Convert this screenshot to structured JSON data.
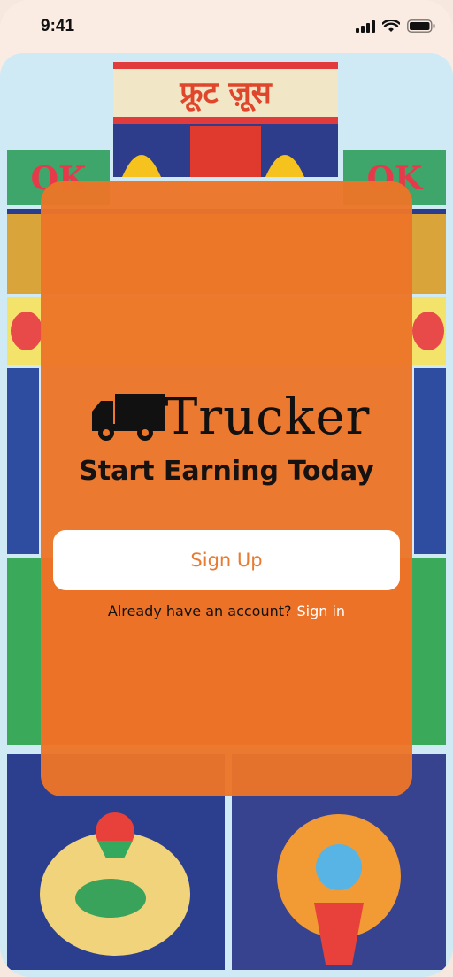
{
  "status": {
    "time": "9:41"
  },
  "art": {
    "top_banner": "फ्रूट ज़ूस",
    "side_label_left": "OK",
    "side_label_right": "OK"
  },
  "hero": {
    "brand": "Trucker",
    "tagline": "Start Earning Today"
  },
  "actions": {
    "signup_label": "Sign Up",
    "account_prompt": "Already have an account?",
    "signin_label": "Sign in"
  },
  "colors": {
    "card": "#EC7528",
    "accent": "#E87B32",
    "page_bg": "#FBECE3"
  }
}
